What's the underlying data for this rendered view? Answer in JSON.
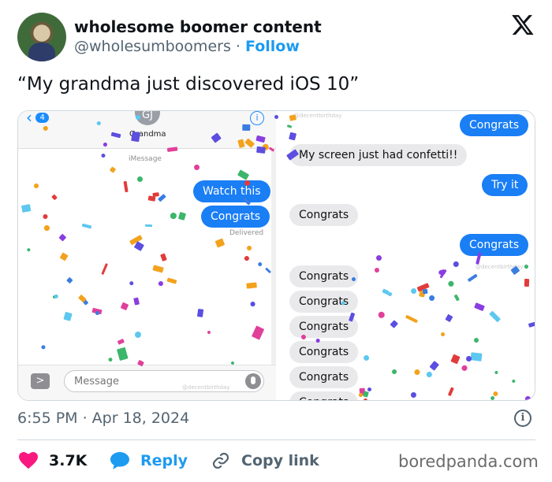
{
  "author": {
    "display_name": "wholesome boomer content",
    "handle": "@wholesumboomers",
    "separator": "·",
    "follow_label": "Follow"
  },
  "tweet": {
    "text": "“My grandma just discovered iOS 10”",
    "timestamp": "6:55 PM · Apr 18, 2024"
  },
  "left_screen": {
    "back_count": "4",
    "contact_initials": "GJ",
    "contact_name": "Grandma",
    "service_label": "iMessage",
    "bubbles": [
      {
        "text": "Watch this",
        "side": "sent"
      },
      {
        "text": "Congrats",
        "side": "sent"
      }
    ],
    "delivered_label": "Delivered",
    "input_placeholder": "Message",
    "watermark": "@decentbirthday"
  },
  "right_screen": {
    "watermark_top": "@decentbirthday",
    "watermark_mid": "@decentbirthday",
    "bubbles": [
      {
        "text": "Congrats",
        "side": "sent"
      },
      {
        "text": "My screen just had confetti!!",
        "side": "received"
      },
      {
        "text": "Try it",
        "side": "sent"
      },
      {
        "text": "Congrats",
        "side": "received"
      },
      {
        "text": "Congrats",
        "side": "sent"
      },
      {
        "text": "Congrats",
        "side": "received"
      },
      {
        "text": "Congrats",
        "side": "received"
      },
      {
        "text": "Congrats",
        "side": "received"
      },
      {
        "text": "Congrats",
        "side": "received"
      },
      {
        "text": "Congrats",
        "side": "received"
      },
      {
        "text": "Congrats",
        "side": "received"
      }
    ]
  },
  "actions": {
    "like_count": "3.7K",
    "reply_label": "Reply",
    "copy_label": "Copy link"
  },
  "source_watermark": "boredpanda.com",
  "colors": {
    "accent": "#1d9bf0",
    "like": "#f91880",
    "imessage_blue": "#1a7ef5",
    "received_gray": "#e9e9ec"
  }
}
